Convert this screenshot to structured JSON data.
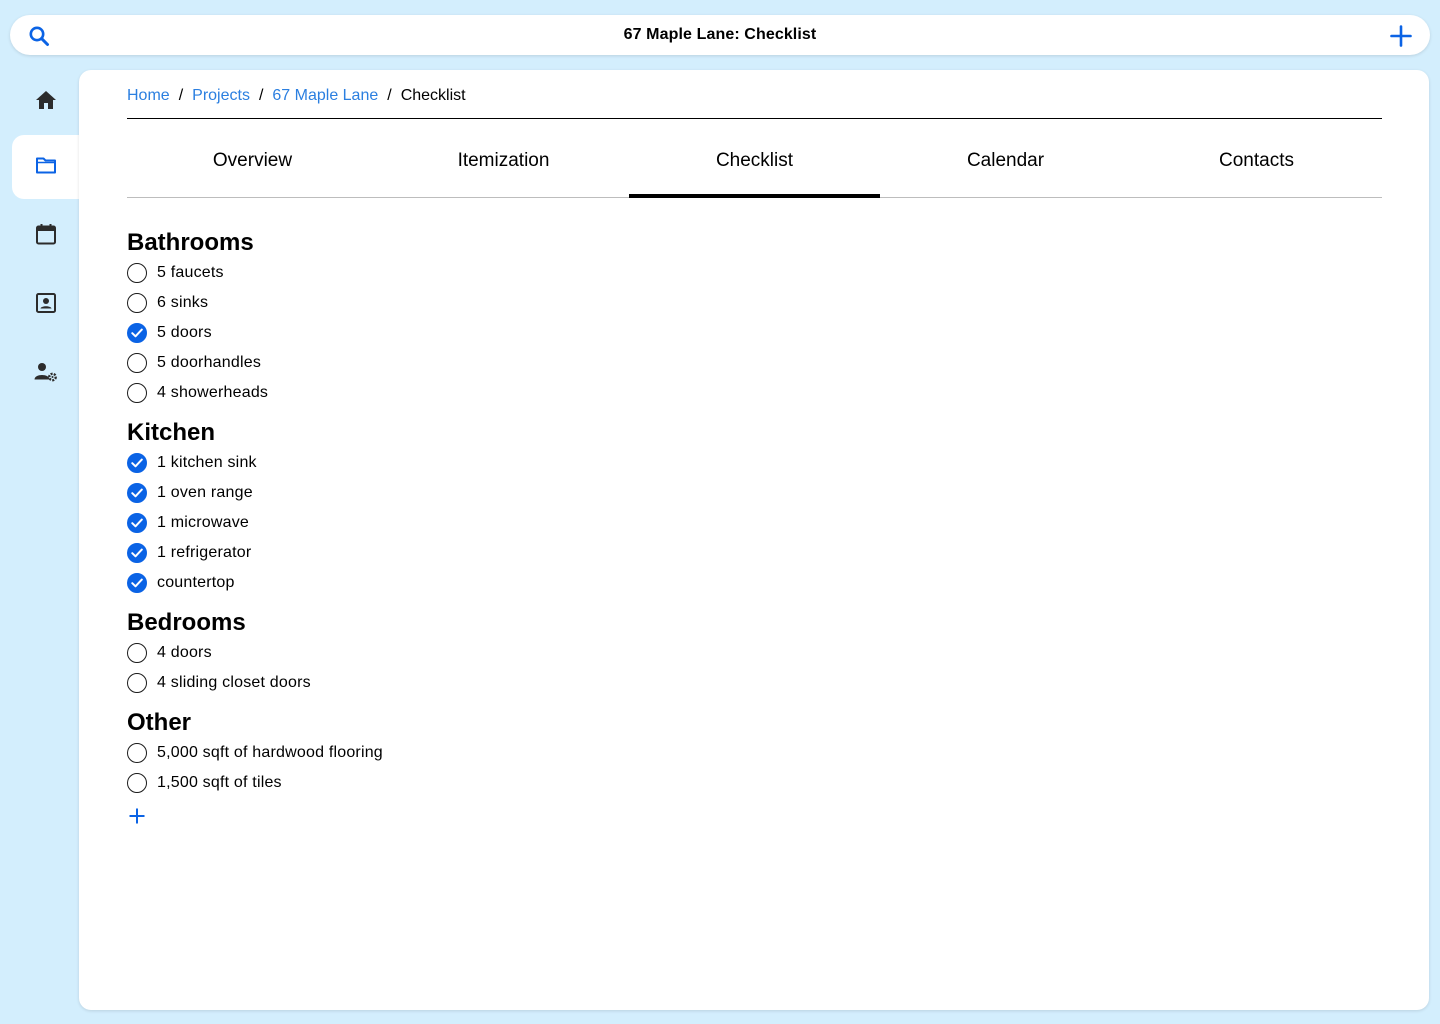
{
  "topbar": {
    "title": "67 Maple Lane: Checklist",
    "search_icon": "search-icon",
    "add_icon": "plus-icon"
  },
  "sidenav": {
    "items": [
      {
        "name": "home",
        "icon": "home-icon"
      },
      {
        "name": "projects",
        "icon": "folder-icon",
        "active": true
      },
      {
        "name": "calendar",
        "icon": "calendar-icon"
      },
      {
        "name": "contacts",
        "icon": "contact-card-icon"
      },
      {
        "name": "user-settings",
        "icon": "user-settings-icon"
      }
    ]
  },
  "breadcrumb": {
    "items": [
      "Home",
      "Projects",
      "67 Maple Lane"
    ],
    "current": "Checklist",
    "separator": "/"
  },
  "tabs": [
    {
      "label": "Overview"
    },
    {
      "label": "Itemization"
    },
    {
      "label": "Checklist",
      "active": true
    },
    {
      "label": "Calendar"
    },
    {
      "label": "Contacts"
    }
  ],
  "checklist": {
    "sections": [
      {
        "title": "Bathrooms",
        "items": [
          {
            "label": "5 faucets",
            "checked": false
          },
          {
            "label": "6 sinks",
            "checked": false
          },
          {
            "label": "5 doors",
            "checked": true
          },
          {
            "label": "5 doorhandles",
            "checked": false
          },
          {
            "label": "4 showerheads",
            "checked": false
          }
        ]
      },
      {
        "title": "Kitchen",
        "items": [
          {
            "label": "1 kitchen sink",
            "checked": true
          },
          {
            "label": "1 oven range",
            "checked": true
          },
          {
            "label": "1 microwave",
            "checked": true
          },
          {
            "label": "1 refrigerator",
            "checked": true
          },
          {
            "label": "countertop",
            "checked": true
          }
        ]
      },
      {
        "title": "Bedrooms",
        "items": [
          {
            "label": "4 doors",
            "checked": false
          },
          {
            "label": "4 sliding closet doors",
            "checked": false
          }
        ]
      },
      {
        "title": "Other",
        "items": [
          {
            "label": "5,000 sqft of hardwood flooring",
            "checked": false
          },
          {
            "label": "1,500 sqft of tiles",
            "checked": false
          }
        ]
      }
    ],
    "add_icon": "plus-icon"
  },
  "colors": {
    "background": "#d3eefd",
    "accent": "#0b63e5",
    "link": "#2b7fe0",
    "nav_icon": "#2c2c2c"
  }
}
